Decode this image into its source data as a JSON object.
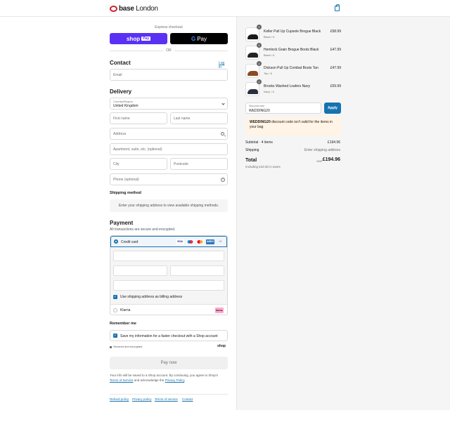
{
  "brand": {
    "name_bold": "base",
    "name_light": " London"
  },
  "header": {
    "bag_icon": "shopping-bag-icon"
  },
  "express": {
    "label": "Express checkout",
    "shop_pay_label": "shop",
    "shop_pay_badge": "Pay",
    "gpay_g": "G",
    "gpay_label": "Pay",
    "or": "OR"
  },
  "contact": {
    "heading": "Contact",
    "login": "Log in",
    "email_placeholder": "Email"
  },
  "delivery": {
    "heading": "Delivery",
    "country_label": "Country/Region",
    "country_value": "United Kingdom",
    "first_name": "First name",
    "last_name": "Last name",
    "address": "Address",
    "apartment": "Apartment, suite, etc. (optional)",
    "city": "City",
    "postcode": "Postcode",
    "phone": "Phone (optional)",
    "help_glyph": "?"
  },
  "shipping": {
    "heading": "Shipping method",
    "notice": "Enter your shipping address to view available shipping methods."
  },
  "payment": {
    "heading": "Payment",
    "subtitle": "All transactions are secure and encrypted.",
    "credit_card": "Credit card",
    "cards": [
      "VISA",
      "",
      "",
      "AMEX",
      "+4"
    ],
    "billing_same": "Use shipping address as billing address",
    "klarna": "Klarna",
    "klarna_badge": "Klarna."
  },
  "remember": {
    "heading": "Remember me",
    "save_info": "Save my information for a faster checkout with a Shop account",
    "secure": "Secured and encrypted",
    "shop_logo": "shop"
  },
  "pay_now": "Pay now",
  "legal": {
    "text1": "Your info will be saved to a Shop account. By continuing, you agree to Shop's",
    "tos": "Terms of Service",
    "text2": "and acknowledge the",
    "privacy": "Privacy Policy",
    "dot": "."
  },
  "footer_links": [
    "Refund policy",
    "Privacy policy",
    "Terms of service",
    "Contact"
  ],
  "cart": {
    "items": [
      {
        "qty": "1",
        "name": "Keller Pull Up Cupsole Brogue Black",
        "variant": "Black / 6",
        "price": "£58.99",
        "color": "#1a1a1a"
      },
      {
        "qty": "1",
        "name": "Hemlock Grain Brogue Boots Black",
        "variant": "Black / 6",
        "price": "£47.99",
        "color": "#222222"
      },
      {
        "qty": "1",
        "name": "Dickson Pull Up Combat Boots Tan",
        "variant": "Tan / 6",
        "price": "£47.99",
        "color": "#8a4a22"
      },
      {
        "qty": "1",
        "name": "Brooks Washed Loafers Navy",
        "variant": "Navy / 6",
        "price": "£59.99",
        "color": "#26303e"
      }
    ],
    "discount_label": "Discount code",
    "discount_value": "WEDDING20",
    "apply": "Apply",
    "warning_code": "WEDDING20",
    "warning_text": " discount code isn't valid for the items in your bag",
    "subtotal_label": "Subtotal · 4 items",
    "subtotal_value": "£194.96",
    "shipping_label": "Shipping",
    "shipping_value": "Enter shipping address",
    "total_label": "Total",
    "currency": "GBP",
    "total_value": "£194.96",
    "taxes": "Including £32.50 in taxes"
  },
  "colors": {
    "accent": "#1773b0",
    "shop_pay": "#5a31f4",
    "warning_bg": "#fff4e5"
  }
}
